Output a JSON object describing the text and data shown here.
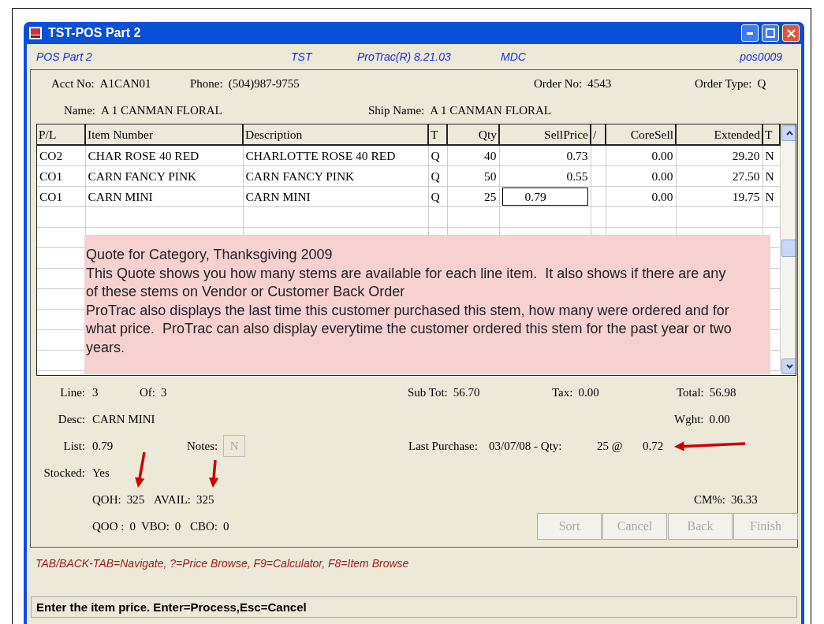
{
  "window": {
    "title": "TST-POS Part 2"
  },
  "info_bar": [
    "POS Part 2",
    "TST",
    "ProTrac(R) 8.21.03",
    "MDC",
    "pos0009"
  ],
  "header": {
    "acct_no": {
      "label": "Acct No:",
      "value": "A1CAN01"
    },
    "phone": {
      "label": "Phone:",
      "value": "(504)987-9755"
    },
    "order_no": {
      "label": "Order No:",
      "value": "4543"
    },
    "order_type": {
      "label": "Order Type:",
      "value": "Q"
    },
    "name": {
      "label": "Name:",
      "value": "A 1 CANMAN FLORAL"
    },
    "ship_name": {
      "label": "Ship Name:",
      "value": "A 1 CANMAN FLORAL"
    }
  },
  "table": {
    "columns": [
      "P/L",
      "Item Number",
      "Description",
      "T",
      "Qty",
      "SellPrice",
      "/",
      "CoreSell",
      "Extended",
      "T"
    ],
    "rows": [
      {
        "cells": [
          "CO2",
          "CHAR ROSE 40 RED",
          "CHARLOTTE ROSE 40 RED",
          "Q",
          "40",
          "0.73",
          "",
          "0.00",
          "29.20",
          "N"
        ],
        "editing": false
      },
      {
        "cells": [
          "CO1",
          "CARN FANCY PINK",
          "CARN FANCY PINK",
          "Q",
          "50",
          "0.55",
          "",
          "0.00",
          "27.50",
          "N"
        ],
        "editing": false
      },
      {
        "cells": [
          "CO1",
          "CARN MINI",
          "CARN MINI",
          "Q",
          "25",
          "0.79",
          "",
          "0.00",
          "19.75",
          "N"
        ],
        "editing": true
      }
    ]
  },
  "note": {
    "title": "Quote for Category, Thanksgiving 2009",
    "paragraphs": [
      "This Quote shows you how many stems are available for each line item.  It also shows if there are any of these stems on Vendor or Customer Back Order",
      "ProTrac also displays the last time this customer purchased this stem, how many were ordered and for what price.  ProTrac can also display everytime the customer ordered this stem for the past year or two years."
    ]
  },
  "summary": {
    "line": {
      "label": "Line:",
      "value": "3"
    },
    "of": {
      "label": "Of:",
      "value": "3"
    },
    "sub_tot": {
      "label": "Sub Tot:",
      "value": "56.70"
    },
    "tax": {
      "label": "Tax:",
      "value": "0.00"
    },
    "total": {
      "label": "Total:",
      "value": "56.98"
    },
    "desc": {
      "label": "Desc:",
      "value": "CARN MINI"
    },
    "wght": {
      "label": "Wght:",
      "value": "0.00"
    },
    "list": {
      "label": "List:",
      "value": "0.79"
    },
    "notes": {
      "label": "Notes:",
      "button": "N",
      "disabled": true
    },
    "last_purchase": {
      "label": "Last Purchase:",
      "date": "03/07/08 - Qty:",
      "qty": "25 @",
      "price": "0.72"
    },
    "stocked": {
      "label": "Stocked:",
      "value": "Yes"
    },
    "qoh": {
      "label": "QOH:",
      "value": "325"
    },
    "avail": {
      "label": "AVAIL:",
      "value": "325"
    },
    "cm": {
      "label": "CM%:",
      "value": "36.33"
    },
    "qoo": {
      "label": "QOO :",
      "value": "0"
    },
    "vbo": {
      "label": "VBO:",
      "value": "0"
    },
    "cbo": {
      "label": "CBO:",
      "value": "0"
    }
  },
  "buttons": [
    {
      "label": "Sort",
      "disabled": true
    },
    {
      "label": "Cancel",
      "disabled": true
    },
    {
      "label": "Back",
      "disabled": true
    },
    {
      "label": "Finish",
      "disabled": true
    }
  ],
  "hint": "TAB/BACK-TAB=Navigate, ?=Price Browse, F9=Calculator, F8=Item Browse",
  "status_bar": "Enter the item price. Enter=Process,Esc=Cancel"
}
